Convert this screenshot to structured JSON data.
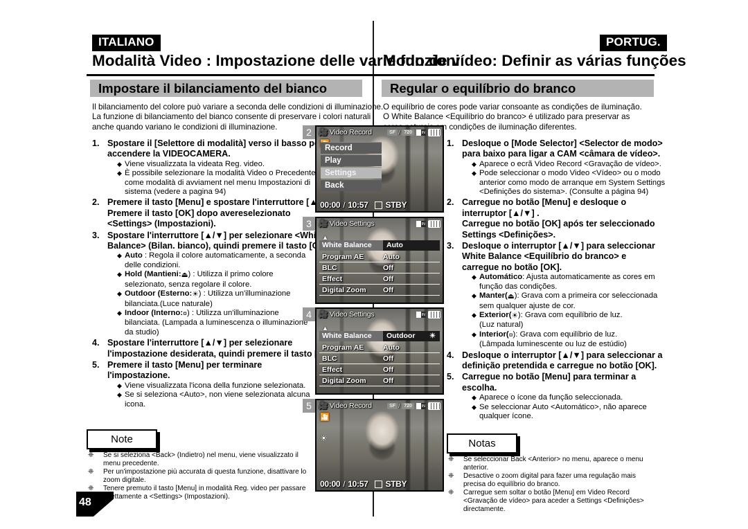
{
  "left": {
    "language_badge": "ITALIANO",
    "chapter_title": "Modalità Video : Impostazione delle varie funzioni",
    "section_title": "Impostare il bilanciamento del bianco",
    "intro": [
      "Il bilanciamento del colore può variare a seconda delle condizioni di illuminazione.",
      "La funzione di bilanciamento del bianco consente di preservare i colori naturali",
      "anche quando variano le condizioni di illuminazione."
    ],
    "steps": [
      {
        "num": "1.",
        "head": [
          "Spostare il [Selettore di modalità] verso il basso per",
          "accendere la VIDEOCAMERA."
        ],
        "bullets": [
          {
            "lines": [
              "Viene visualizzata la videata Reg. video."
            ]
          },
          {
            "lines": [
              "È possibile selezionare la modalità Video o Precedente",
              "come modalità di avviament nel menu Impostazioni di",
              "sistema (vedere a pagina 94)"
            ]
          }
        ]
      },
      {
        "num": "2.",
        "head": [
          "Premere il tasto [Menu] e spostare l'interruttore [▲/▼].",
          "Premere il tasto [OK] dopo avereselezionato",
          "<Settings> (Impostazioni)."
        ],
        "bullets": []
      },
      {
        "num": "3.",
        "head": [
          "Spostare l'interruttore [▲/▼] per selezionare <White",
          "Balance> (Bilan. bianco), quindi premere il tasto [OK]."
        ],
        "bullets": [
          {
            "bold": "Auto",
            "lines": [
              " : Regola il colore automaticamente, a seconda",
              "delle condizioni."
            ]
          },
          {
            "bold": "Hold (Mantieni:",
            "icon": "hold",
            "lines": [
              ") : Utilizza il primo colore",
              "selezionato, senza regolare il colore."
            ]
          },
          {
            "bold": "Outdoor (Esterno:",
            "icon": "sun",
            "lines": [
              ") : Utilizza un'illuminazione",
              "bilanciata.(Luce naturale)"
            ]
          },
          {
            "bold": "Indoor (Interno:",
            "icon": "bulb",
            "lines": [
              ") : Utilizza un'illuminazione",
              "bilanciata. (Lampada a luminescenza o illuminazione",
              "da studio)"
            ]
          }
        ]
      },
      {
        "num": "4.",
        "head": [
          "Spostare l'interruttore [▲/▼] per selezionare",
          "l'impostazione desiderata, quindi premere il tasto [OK]."
        ],
        "bullets": []
      },
      {
        "num": "5.",
        "head": [
          "Premere il tasto [Menu] per terminare",
          "l'impostazione."
        ],
        "bullets": [
          {
            "lines": [
              "Viene visualizzata l'icona della funzione selezionata."
            ]
          },
          {
            "lines": [
              "Se si seleziona <Auto>, non viene selezionata alcuna",
              "icona."
            ]
          }
        ]
      }
    ],
    "note_label": "Note",
    "notes": [
      [
        "Se si seleziona <Back> (Indietro) nel menu, viene visualizzato il",
        "menu precedente."
      ],
      [
        "Per un'impostazione più accurata di questa funzione, disattivare lo",
        "zoom digitale."
      ],
      [
        "Tenere premuto il tasto [Menu] in modalità Reg. video per passare",
        "direttamente a <Settings> (Impostazioni)."
      ]
    ]
  },
  "right": {
    "language_badge": "PORTUG.",
    "chapter_title": "Modo de vídeo: Definir as várias funções",
    "section_title": "Regular o equilíbrio do branco",
    "intro": [
      "O equilíbrio de cores pode variar consoante as condições de iluminação.",
      "O White Balance <Equilíbrio do branco> é utilizado para preservar as",
      "cores naturais em condições de iluminação diferentes."
    ],
    "steps": [
      {
        "num": "1.",
        "head": [
          "Desloque o [Mode Selector] <Selector de modo>",
          "para baixo para ligar a CAM <câmara de vídeo>."
        ],
        "bullets": [
          {
            "lines": [
              "Aparece o ecrã Video Record <Gravação de vídeo>."
            ]
          },
          {
            "lines": [
              "Pode seleccionar o modo Video <Vídeo> ou o modo",
              "anterior como modo de arranque em System Settings",
              "<Definições do sistema>. (Consulte a página 94)"
            ]
          }
        ]
      },
      {
        "num": "2.",
        "head": [
          "Carregue no botão [Menu] e desloque o",
          "interruptor [▲/▼] .",
          "Carregue no botão [OK] após ter seleccionado",
          "Settings <Definições>."
        ],
        "bullets": []
      },
      {
        "num": "3.",
        "head": [
          "Desloque o interruptor [▲/▼] para seleccionar",
          "White Balance <Equilíbrio do branco> e",
          "carregue no botão [OK]."
        ],
        "bullets": [
          {
            "bold": "Automático",
            "lines": [
              ": Ajusta automaticamente as cores em",
              "função das condições."
            ]
          },
          {
            "bold": "Manter(",
            "icon": "hold",
            "lines": [
              "): Grava com a primeira cor seleccionada",
              "sem qualquer ajuste de cor."
            ]
          },
          {
            "bold": "Exterior(",
            "icon": "sun",
            "lines": [
              "): Grava com equilíbrio de luz.",
              "(Luz natural)"
            ]
          },
          {
            "bold": "Interior(",
            "icon": "bulb",
            "lines": [
              "): Grava com equilíbrio de luz.",
              "(Lâmpada luminescente ou luz de estúdio)"
            ]
          }
        ]
      },
      {
        "num": "4.",
        "head": [
          "Desloque o interruptor [▲/▼] para seleccionar a",
          "definição pretendida e carregue no botão [OK]."
        ],
        "bullets": []
      },
      {
        "num": "5.",
        "head": [
          "Carregue no botão [Menu] para terminar a",
          "escolha."
        ],
        "bullets": [
          {
            "lines": [
              "Aparece o ícone da função seleccionada."
            ]
          },
          {
            "lines": [
              "Se seleccionar Auto <Automático>, não aparece",
              "qualquer ícone."
            ]
          }
        ]
      }
    ],
    "note_label": "Notas",
    "notes": [
      [
        "Se seleccionar Back <Anterior> no menu, aparece o menu",
        "anterior."
      ],
      [
        "Desactive o zoom digital para fazer uma regulação mais",
        "precisa do equilíbrio do branco."
      ],
      [
        "Carregue sem soltar o botão [Menu] em Video Record",
        "<Gravação de vídeo> para aceder a Settings <Definições>",
        "directamente."
      ]
    ]
  },
  "page_number": "48",
  "screens": [
    {
      "badge": "2",
      "mode_label": "Video Record",
      "quality_chip": "SF",
      "resolution_chip": "720",
      "menu_items": [
        {
          "label": "Record",
          "selected": false
        },
        {
          "label": "Play",
          "selected": false
        },
        {
          "label": "Settings",
          "selected": true
        },
        {
          "label": "Back",
          "selected": false
        }
      ],
      "elapsed": "00:00",
      "remaining": "10:57",
      "status": "STBY"
    },
    {
      "badge": "3",
      "mode_label": "Video Settings",
      "rows": [
        {
          "key": "White Balance",
          "value": "Auto",
          "highlight": true,
          "icon": ""
        },
        {
          "key": "Program AE",
          "value": "Auto",
          "highlight": false
        },
        {
          "key": "BLC",
          "value": "Off",
          "highlight": false
        },
        {
          "key": "Effect",
          "value": "Off",
          "highlight": false
        },
        {
          "key": "Digital Zoom",
          "value": "Off",
          "highlight": false
        }
      ]
    },
    {
      "badge": "4",
      "mode_label": "Video Settings",
      "rows": [
        {
          "key": "White Balance",
          "value": "Outdoor",
          "highlight": true,
          "icon": "sun"
        },
        {
          "key": "Program AE",
          "value": "Auto",
          "highlight": false
        },
        {
          "key": "BLC",
          "value": "Off",
          "highlight": false
        },
        {
          "key": "Effect",
          "value": "Off",
          "highlight": false
        },
        {
          "key": "Digital Zoom",
          "value": "Off",
          "highlight": false
        }
      ]
    },
    {
      "badge": "5",
      "mode_label": "Video Record",
      "quality_chip": "SF",
      "resolution_chip": "720",
      "wb_icon": "sun",
      "elapsed": "00:00",
      "remaining": "10:57",
      "status": "STBY"
    }
  ]
}
